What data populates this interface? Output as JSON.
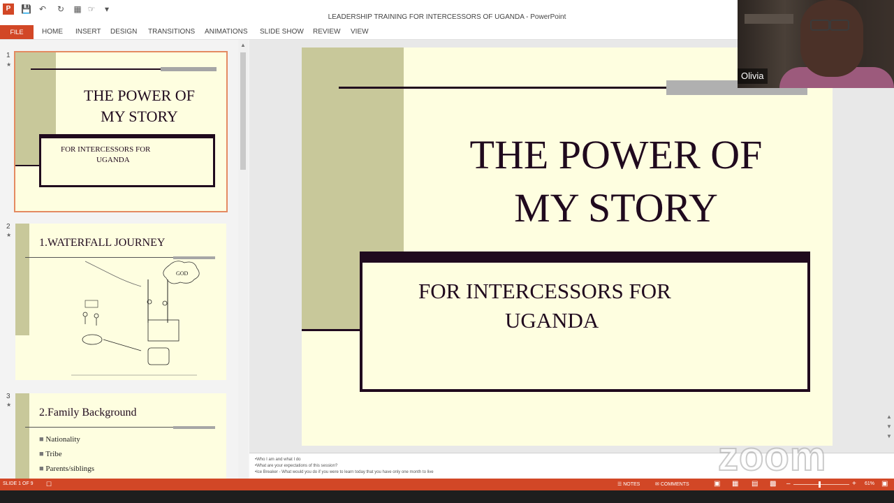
{
  "window": {
    "title": "LEADERSHIP TRAINING FOR INTERCESSORS OF UGANDA - PowerPoint",
    "app_logo": "P"
  },
  "ribbon": {
    "tabs": [
      "FILE",
      "HOME",
      "INSERT",
      "DESIGN",
      "TRANSITIONS",
      "ANIMATIONS",
      "SLIDE SHOW",
      "REVIEW",
      "VIEW"
    ]
  },
  "thumbnails": [
    {
      "number": "1",
      "title_line1": "THE POWER OF",
      "title_line2": "MY STORY",
      "subtitle_line1": "FOR INTERCESSORS FOR",
      "subtitle_line2": "UGANDA"
    },
    {
      "number": "2",
      "title": "1.WATERFALL JOURNEY",
      "diagram_label": "GOD"
    },
    {
      "number": "3",
      "title": "2.Family Background",
      "bullets": [
        "Nationality",
        "Tribe",
        "Parents/siblings"
      ]
    }
  ],
  "slide": {
    "title_line1": "THE POWER OF",
    "title_line2": "MY STORY",
    "subtitle_line1": "FOR INTERCESSORS FOR",
    "subtitle_line2": "UGANDA"
  },
  "notes": {
    "lines": [
      "•Who I am and what I do",
      "•What are your expectations of this session?",
      "•Ice Breaker - What would you do if you were to learn today that you have only one month to live"
    ]
  },
  "status": {
    "slide_indicator": "SLIDE 1 OF 9",
    "notes_label": "NOTES",
    "comments_label": "COMMENTS",
    "zoom": "61%"
  },
  "video": {
    "participant_name": "Olivia",
    "watermark": "zoom"
  },
  "colors": {
    "accent": "#d24726",
    "slide_bg": "#fefee0",
    "olive": "#c8c89a",
    "dark_purple": "#200a1e"
  },
  "icons": [
    "save-icon",
    "undo-icon",
    "redo-icon",
    "start-from-beginning-icon",
    "notes-icon",
    "comments-icon",
    "normal-view-icon",
    "slide-sorter-icon",
    "reading-view-icon",
    "slideshow-icon",
    "zoom-out-icon",
    "zoom-in-icon",
    "fit-slide-icon"
  ]
}
